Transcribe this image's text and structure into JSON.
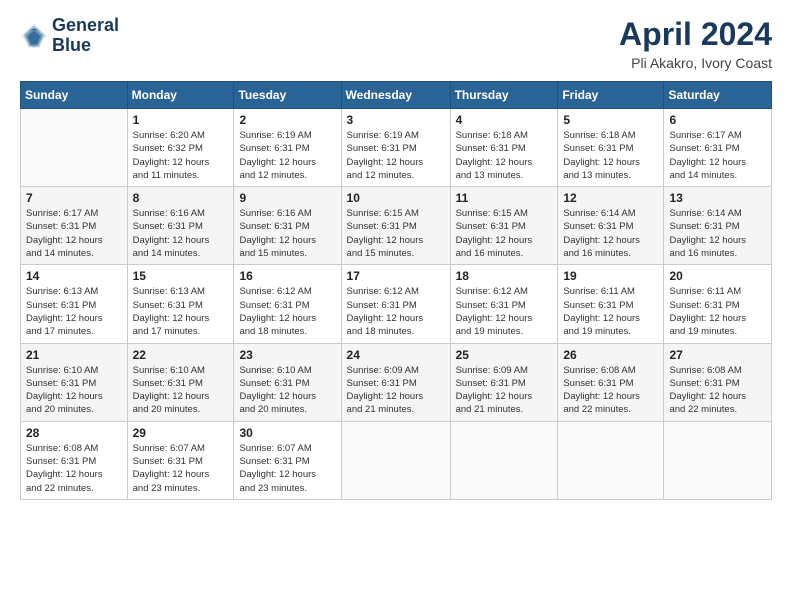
{
  "logo": {
    "line1": "General",
    "line2": "Blue"
  },
  "header": {
    "month": "April 2024",
    "location": "Pli Akakro, Ivory Coast"
  },
  "weekdays": [
    "Sunday",
    "Monday",
    "Tuesday",
    "Wednesday",
    "Thursday",
    "Friday",
    "Saturday"
  ],
  "weeks": [
    [
      {
        "day": "",
        "info": ""
      },
      {
        "day": "1",
        "info": "Sunrise: 6:20 AM\nSunset: 6:32 PM\nDaylight: 12 hours\nand 11 minutes."
      },
      {
        "day": "2",
        "info": "Sunrise: 6:19 AM\nSunset: 6:31 PM\nDaylight: 12 hours\nand 12 minutes."
      },
      {
        "day": "3",
        "info": "Sunrise: 6:19 AM\nSunset: 6:31 PM\nDaylight: 12 hours\nand 12 minutes."
      },
      {
        "day": "4",
        "info": "Sunrise: 6:18 AM\nSunset: 6:31 PM\nDaylight: 12 hours\nand 13 minutes."
      },
      {
        "day": "5",
        "info": "Sunrise: 6:18 AM\nSunset: 6:31 PM\nDaylight: 12 hours\nand 13 minutes."
      },
      {
        "day": "6",
        "info": "Sunrise: 6:17 AM\nSunset: 6:31 PM\nDaylight: 12 hours\nand 14 minutes."
      }
    ],
    [
      {
        "day": "7",
        "info": "Sunrise: 6:17 AM\nSunset: 6:31 PM\nDaylight: 12 hours\nand 14 minutes."
      },
      {
        "day": "8",
        "info": "Sunrise: 6:16 AM\nSunset: 6:31 PM\nDaylight: 12 hours\nand 14 minutes."
      },
      {
        "day": "9",
        "info": "Sunrise: 6:16 AM\nSunset: 6:31 PM\nDaylight: 12 hours\nand 15 minutes."
      },
      {
        "day": "10",
        "info": "Sunrise: 6:15 AM\nSunset: 6:31 PM\nDaylight: 12 hours\nand 15 minutes."
      },
      {
        "day": "11",
        "info": "Sunrise: 6:15 AM\nSunset: 6:31 PM\nDaylight: 12 hours\nand 16 minutes."
      },
      {
        "day": "12",
        "info": "Sunrise: 6:14 AM\nSunset: 6:31 PM\nDaylight: 12 hours\nand 16 minutes."
      },
      {
        "day": "13",
        "info": "Sunrise: 6:14 AM\nSunset: 6:31 PM\nDaylight: 12 hours\nand 16 minutes."
      }
    ],
    [
      {
        "day": "14",
        "info": "Sunrise: 6:13 AM\nSunset: 6:31 PM\nDaylight: 12 hours\nand 17 minutes."
      },
      {
        "day": "15",
        "info": "Sunrise: 6:13 AM\nSunset: 6:31 PM\nDaylight: 12 hours\nand 17 minutes."
      },
      {
        "day": "16",
        "info": "Sunrise: 6:12 AM\nSunset: 6:31 PM\nDaylight: 12 hours\nand 18 minutes."
      },
      {
        "day": "17",
        "info": "Sunrise: 6:12 AM\nSunset: 6:31 PM\nDaylight: 12 hours\nand 18 minutes."
      },
      {
        "day": "18",
        "info": "Sunrise: 6:12 AM\nSunset: 6:31 PM\nDaylight: 12 hours\nand 19 minutes."
      },
      {
        "day": "19",
        "info": "Sunrise: 6:11 AM\nSunset: 6:31 PM\nDaylight: 12 hours\nand 19 minutes."
      },
      {
        "day": "20",
        "info": "Sunrise: 6:11 AM\nSunset: 6:31 PM\nDaylight: 12 hours\nand 19 minutes."
      }
    ],
    [
      {
        "day": "21",
        "info": "Sunrise: 6:10 AM\nSunset: 6:31 PM\nDaylight: 12 hours\nand 20 minutes."
      },
      {
        "day": "22",
        "info": "Sunrise: 6:10 AM\nSunset: 6:31 PM\nDaylight: 12 hours\nand 20 minutes."
      },
      {
        "day": "23",
        "info": "Sunrise: 6:10 AM\nSunset: 6:31 PM\nDaylight: 12 hours\nand 20 minutes."
      },
      {
        "day": "24",
        "info": "Sunrise: 6:09 AM\nSunset: 6:31 PM\nDaylight: 12 hours\nand 21 minutes."
      },
      {
        "day": "25",
        "info": "Sunrise: 6:09 AM\nSunset: 6:31 PM\nDaylight: 12 hours\nand 21 minutes."
      },
      {
        "day": "26",
        "info": "Sunrise: 6:08 AM\nSunset: 6:31 PM\nDaylight: 12 hours\nand 22 minutes."
      },
      {
        "day": "27",
        "info": "Sunrise: 6:08 AM\nSunset: 6:31 PM\nDaylight: 12 hours\nand 22 minutes."
      }
    ],
    [
      {
        "day": "28",
        "info": "Sunrise: 6:08 AM\nSunset: 6:31 PM\nDaylight: 12 hours\nand 22 minutes."
      },
      {
        "day": "29",
        "info": "Sunrise: 6:07 AM\nSunset: 6:31 PM\nDaylight: 12 hours\nand 23 minutes."
      },
      {
        "day": "30",
        "info": "Sunrise: 6:07 AM\nSunset: 6:31 PM\nDaylight: 12 hours\nand 23 minutes."
      },
      {
        "day": "",
        "info": ""
      },
      {
        "day": "",
        "info": ""
      },
      {
        "day": "",
        "info": ""
      },
      {
        "day": "",
        "info": ""
      }
    ]
  ]
}
